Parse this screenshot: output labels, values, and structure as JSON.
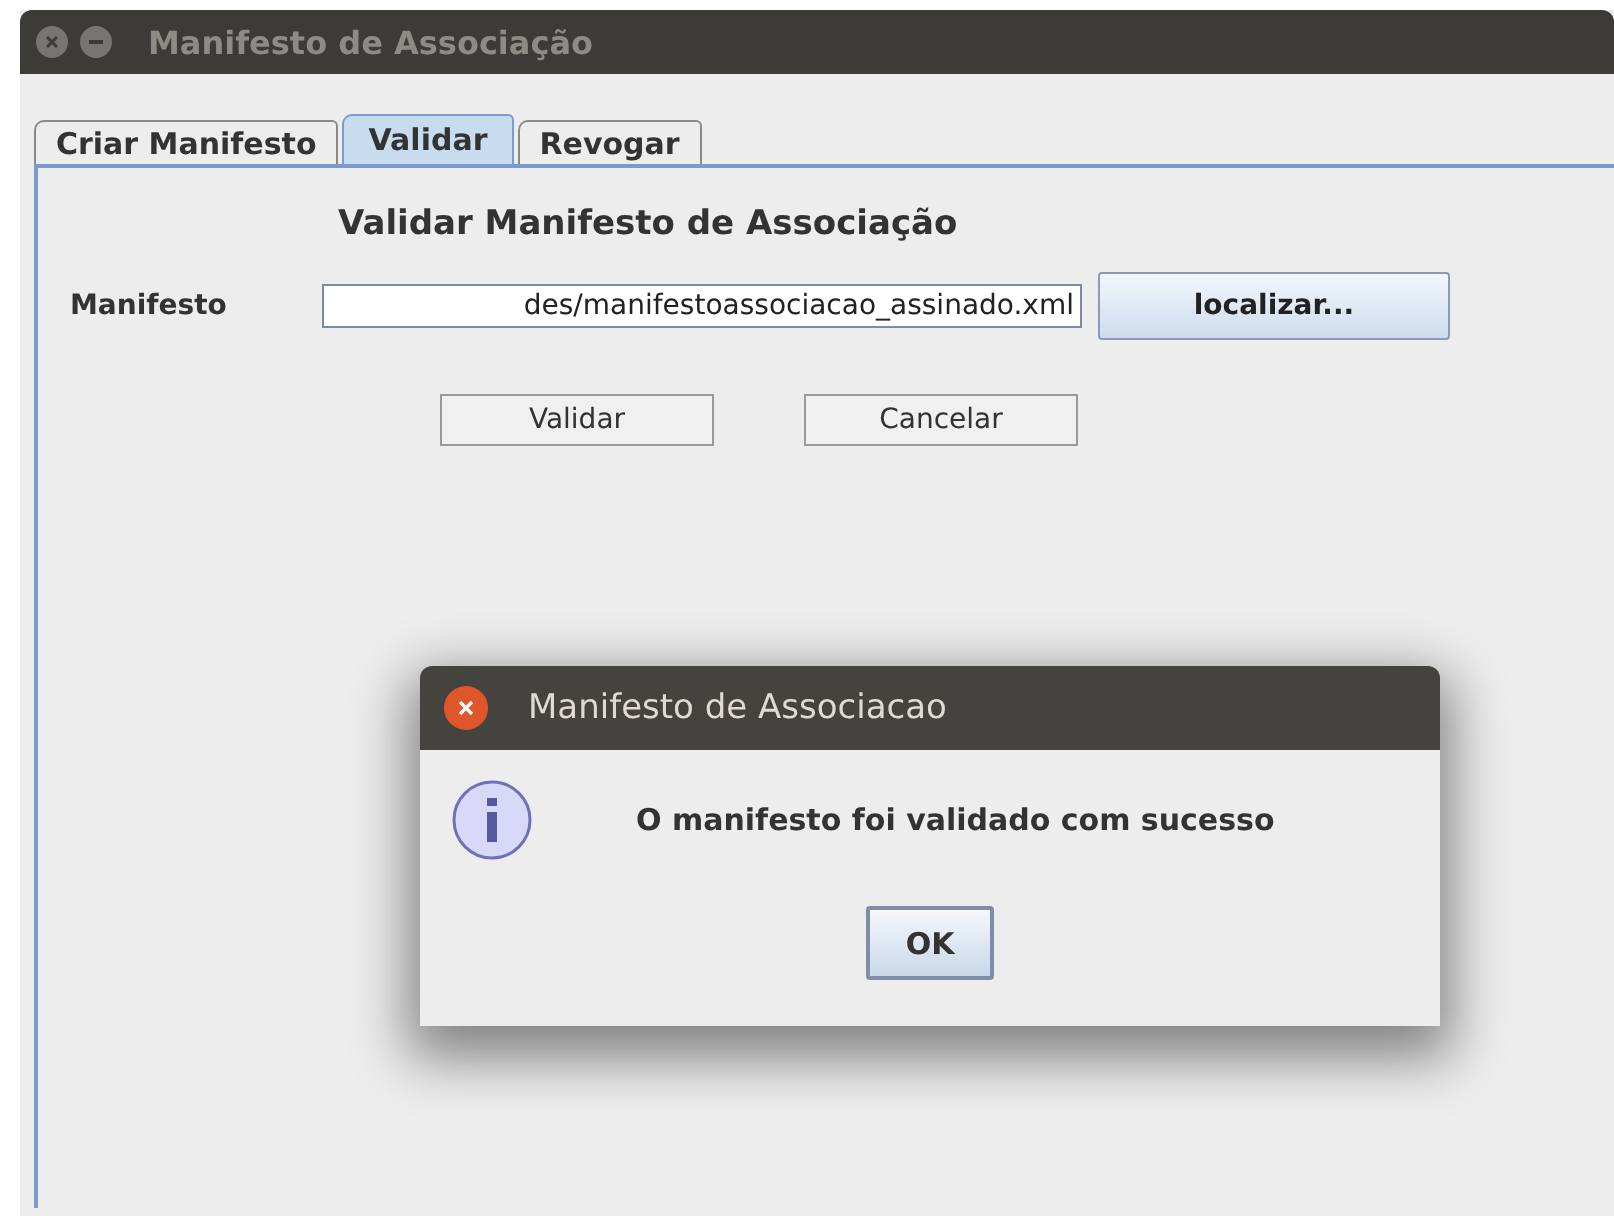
{
  "window": {
    "title": "Manifesto de Associação",
    "focused": false
  },
  "tabs": [
    {
      "label": "Criar Manifesto",
      "selected": false
    },
    {
      "label": "Validar",
      "selected": true
    },
    {
      "label": "Revogar",
      "selected": false
    }
  ],
  "form": {
    "heading": "Validar Manifesto de Associação",
    "field_label": "Manifesto",
    "field_value": "des/manifestoassociacao_assinado.xml",
    "browse_button": "localizar...",
    "buttons": [
      "Validar",
      "Cancelar"
    ]
  },
  "dialog": {
    "title": "Manifesto de Associacao",
    "message": "O manifesto foi validado com sucesso",
    "button": "OK"
  }
}
